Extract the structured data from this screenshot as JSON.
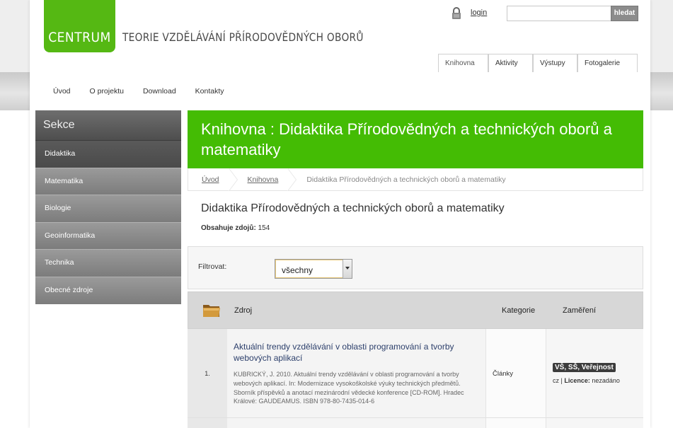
{
  "header": {
    "logo_text": "CENTRUM",
    "site_title": "TEORIE VZDĚLÁVÁNÍ PŘÍRODOVĚDNÝCH OBORŮ",
    "login_label": "login",
    "search_placeholder": "",
    "search_button": "hledat"
  },
  "top_tabs": [
    "Knihovna",
    "Aktivity",
    "Výstupy",
    "Fotogalerie"
  ],
  "nav": [
    "Úvod",
    "O projektu",
    "Download",
    "Kontakty"
  ],
  "sidebar": {
    "title": "Sekce",
    "items": [
      "Didaktika",
      "Matematika",
      "Biologie",
      "Geoinformatika",
      "Technika",
      "Obecné zdroje"
    ]
  },
  "main": {
    "header_title": "Knihovna : Didaktika Přírodovědných a technických oborů a matematiky",
    "breadcrumb": [
      "Úvod",
      "Knihovna",
      "Didaktika Přírodovědných a technických oborů a matematiky"
    ],
    "page_title": "Didaktika Přírodovědných a technických oborů a matematiky",
    "count_label": "Obsahuje zdojů:",
    "count_value": "154",
    "filter_label": "Filtrovat:",
    "filter_value": "všechny"
  },
  "table": {
    "headers": [
      "Zdroj",
      "Kategorie",
      "Zaměření"
    ],
    "rows": [
      {
        "num": "1.",
        "title": "Aktuální trendy vzdělávání v oblasti programování a tvorby webových aplikací",
        "citation": "KUBRICKÝ, J. 2010. Aktuální trendy vzdělávání v oblasti programování a tvorby webových aplikací. In: Modernizace vysokoškolské výuky technických předmětů. Sborník příspěvků a anotací mezinárodní vědecké konference [CD-ROM]. Hradec Králové: GAUDEAMUS. ISBN 978-80-7435-014-6",
        "category": "Články",
        "focus_badge": "VŠ, SŠ, Veřejnost",
        "lang": "cz",
        "license_label": "Licence:",
        "license_value": "nezadáno"
      }
    ]
  },
  "colors": {
    "brand_green": "#55b813",
    "header_green": "#44bc04",
    "sidebar_active": "#4e4e4e",
    "link_blue": "#2c3f6b"
  }
}
